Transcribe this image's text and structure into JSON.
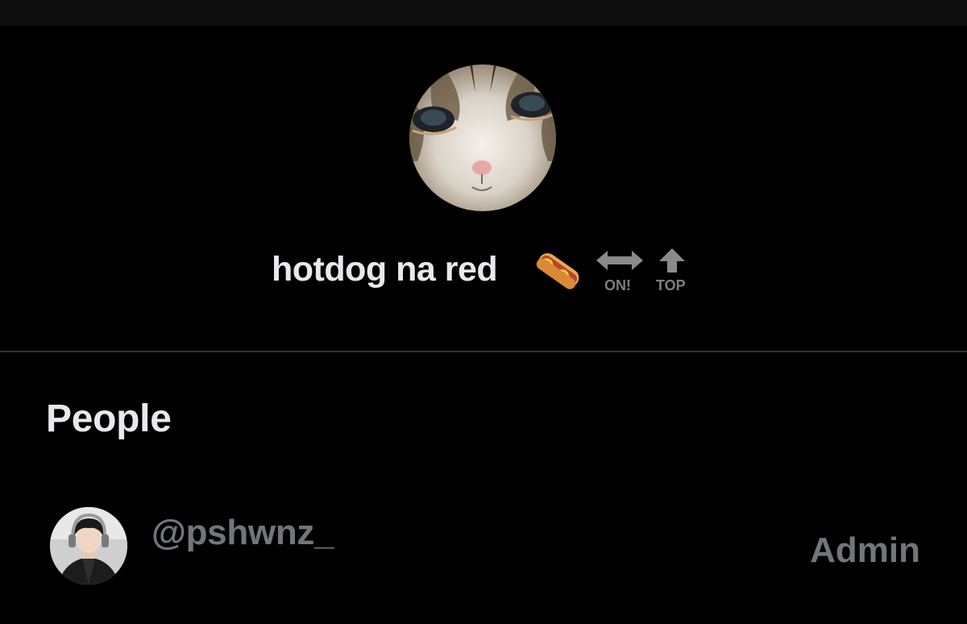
{
  "group": {
    "name": "hotdog na red",
    "emoji_icons": [
      {
        "name": "hotdog-emoji",
        "label": ""
      },
      {
        "name": "on-arrow-icon",
        "label": "ON!"
      },
      {
        "name": "top-arrow-icon",
        "label": "TOP"
      }
    ],
    "avatar": "cat-photo"
  },
  "people": {
    "title": "People",
    "members": [
      {
        "handle": "@pshwnz_",
        "role": "Admin",
        "avatar": "person-photo"
      }
    ]
  },
  "colors": {
    "background": "#000000",
    "primary_text": "#e7e9ea",
    "secondary_text": "#71767b",
    "divider": "#2f3336"
  }
}
